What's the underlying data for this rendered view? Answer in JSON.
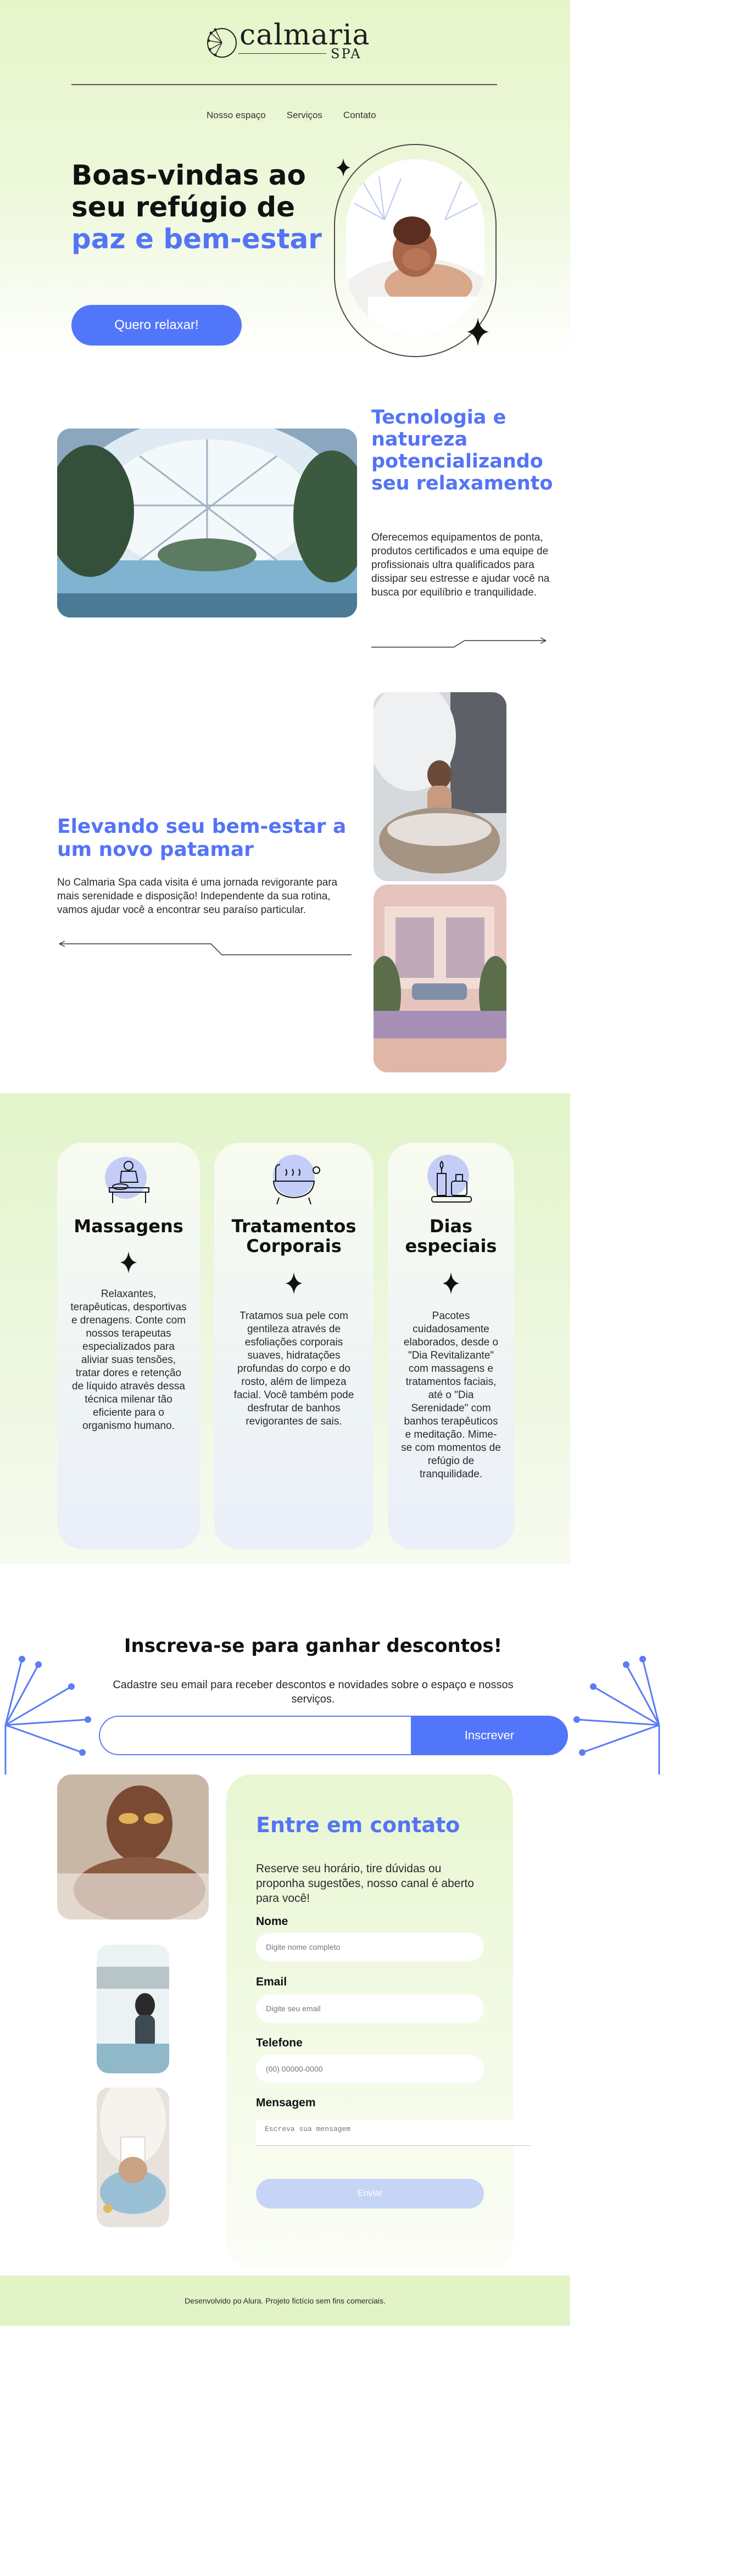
{
  "brand": {
    "name": "calmaria",
    "sub": "SPA"
  },
  "nav": {
    "items": [
      "Nosso espaço",
      "Serviços",
      "Contato"
    ]
  },
  "hero": {
    "title_part1": "Boas-vindas ao seu refúgio de ",
    "title_highlight": "paz e bem-estar",
    "button": "Quero relaxar!"
  },
  "tech": {
    "title": "Tecnologia e natureza potencializando seu relaxamento",
    "text": "Oferecemos equipamentos de ponta, produtos certificados e uma equipe de profissionais ultra qualificados para dissipar seu estresse e ajudar você na busca por equilíbrio e tranquilidade."
  },
  "elevate": {
    "title": "Elevando seu bem-estar a um novo patamar",
    "text": "No Calmaria Spa cada visita é uma jornada revigorante para mais serenidade e disposição! Independente da sua rotina, vamos ajudar você a encontrar seu paraíso particular."
  },
  "services": [
    {
      "title": "Massagens",
      "icon": "massage-icon",
      "text": "Relaxantes, terapêuticas, desportivas e drenagens. Conte com nossos terapeutas especializados para aliviar suas tensões, tratar dores e retenção de líquido através dessa técnica milenar tão eficiente para o organismo humano."
    },
    {
      "title": "Tratamentos Corporais",
      "icon": "bathtub-icon",
      "text": "Tratamos sua pele com gentileza através de esfoliações corporais suaves, hidratações profundas do corpo e do rosto, além de limpeza facial. Você também pode desfrutar de banhos revigorantes de sais."
    },
    {
      "title": "Dias especiais",
      "icon": "candles-icon",
      "text": "Pacotes cuidadosamente elaborados, desde o \"Dia Revitalizante\" com massagens e tratamentos faciais, até o \"Dia Serenidade\" com banhos terapêuticos e meditação. Mime-se com momentos de refúgio de tranquilidade."
    }
  ],
  "subscribe": {
    "title": "Inscreva-se para ganhar descontos!",
    "text": "Cadastre seu email para receber descontos e novidades sobre o espaço e nossos serviços.",
    "input_placeholder": "",
    "button": "Inscrever"
  },
  "contact": {
    "title": "Entre em contato",
    "text": "Reserve seu horário, tire dúvidas ou proponha sugestões, nosso canal é aberto para você!",
    "name_label": "Nome",
    "name_placeholder": "Digite nome completo",
    "email_label": "Email",
    "email_placeholder": "Digite seu email",
    "phone_label": "Telefone",
    "phone_placeholder": "(00) 00000-0000",
    "message_label": "Mensagem",
    "message_placeholder": "Escreva sua mensagem",
    "send_button": "Enviar"
  },
  "footer": {
    "text": "Desenvolvido po Alura. Projeto fictício sem fins comerciais."
  },
  "colors": {
    "accent": "#5276fa",
    "title_blue": "#5474f5",
    "hero_bg": "#e6f5c9",
    "footer_bg": "#e2f4c6"
  }
}
